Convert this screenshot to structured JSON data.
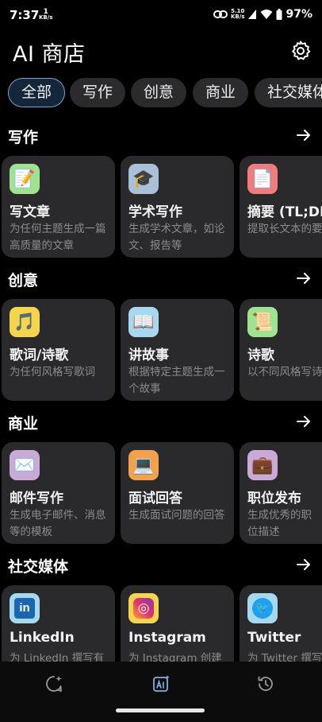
{
  "status_bar": {
    "time": "7:37",
    "net_speed_value": "1",
    "net_speed_unit": "KB/s",
    "speed2_value": "5.10",
    "speed2_unit": "KB/s",
    "battery": "97%"
  },
  "header": {
    "title": "AI 商店"
  },
  "tabs": [
    {
      "label": "全部",
      "active": true
    },
    {
      "label": "写作"
    },
    {
      "label": "创意"
    },
    {
      "label": "商业"
    },
    {
      "label": "社交媒体"
    }
  ],
  "sections": [
    {
      "title": "写作",
      "cards": [
        {
          "icon": "memo-icon",
          "icon_bg": "#9fe38f",
          "glyph": "📝",
          "title": "写文章",
          "desc": "为任何主题生成一篇高质量的文章"
        },
        {
          "icon": "graduation-cap-icon",
          "icon_bg": "#a9c1d6",
          "glyph": "🎓",
          "title": "学术写作",
          "desc": "生成学术文章，如论文、报告等"
        },
        {
          "icon": "document-icon",
          "icon_bg": "#f27c7c",
          "glyph": "📄",
          "title": "摘要 (TL;DR)",
          "desc": "提取长文本的要点"
        }
      ]
    },
    {
      "title": "创意",
      "cards": [
        {
          "icon": "music-note-icon",
          "icon_bg": "#f4d54c",
          "glyph": "🎵",
          "title": "歌词/诗歌",
          "desc": "为任何风格写歌词"
        },
        {
          "icon": "open-book-icon",
          "icon_bg": "#a6d8ee",
          "glyph": "📖",
          "title": "讲故事",
          "desc": "根据特定主题生成一个故事"
        },
        {
          "icon": "scroll-icon",
          "icon_bg": "#9ee38f",
          "glyph": "📜",
          "title": "诗歌",
          "desc": "以不同风格写诗"
        }
      ]
    },
    {
      "title": "商业",
      "cards": [
        {
          "icon": "envelope-icon",
          "icon_bg": "#c9a9d6",
          "glyph": "✉️",
          "title": "邮件写作",
          "desc": "生成电子邮件、消息等的模板"
        },
        {
          "icon": "laptop-icon",
          "icon_bg": "#f4a14c",
          "glyph": "💻",
          "title": "面试回答",
          "desc": "生成面试问题的回答"
        },
        {
          "icon": "briefcase-icon",
          "icon_bg": "#c9a9d6",
          "glyph": "💼",
          "title": "职位发布",
          "desc": "生成优秀的职位描述"
        }
      ]
    },
    {
      "title": "社交媒体",
      "cards": [
        {
          "icon": "linkedin-icon",
          "icon_bg": "#a6d8ee",
          "glyph": "in",
          "title": "LinkedIn",
          "desc": "为 LinkedIn 撰写有吸引力的帖子"
        },
        {
          "icon": "instagram-icon",
          "icon_bg": "#f4d54c",
          "glyph": "◎",
          "title": "Instagram",
          "desc": "为 Instagram 创建帖子"
        },
        {
          "icon": "twitter-icon",
          "icon_bg": "#a6d8ee",
          "glyph": "🐦",
          "title": "Twitter",
          "desc": "为 Twitter 撰写推文"
        }
      ]
    }
  ],
  "bottom_nav": [
    {
      "icon": "chat-sparkle-icon",
      "active": false
    },
    {
      "icon": "ai-store-icon",
      "active": true
    },
    {
      "icon": "history-icon",
      "active": false
    }
  ],
  "colors": {
    "accent": "#6fa7d8",
    "card_bg": "#2a2a2c",
    "desc_text": "#8b8b8e"
  }
}
